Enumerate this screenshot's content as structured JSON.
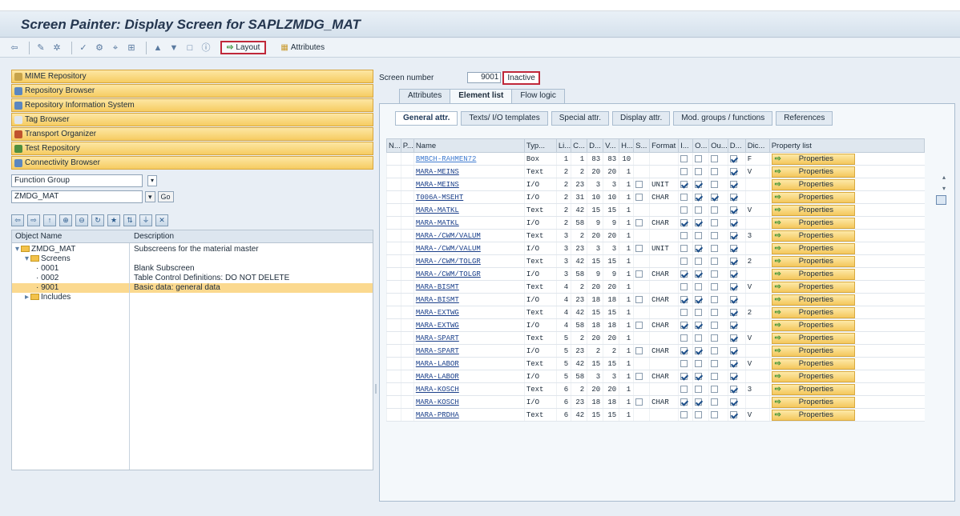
{
  "title": "Screen Painter: Display Screen for SAPLZMDG_MAT",
  "toolbar": {
    "layout_label": "Layout",
    "attributes_label": "Attributes"
  },
  "nav_buttons": [
    {
      "label": "MIME Repository",
      "icon_color": "#c7a34a"
    },
    {
      "label": "Repository Browser",
      "icon_color": "#5b87c0"
    },
    {
      "label": "Repository Information System",
      "icon_color": "#5b87c0"
    },
    {
      "label": "Tag Browser",
      "icon_color": "#e0e6ee"
    },
    {
      "label": "Transport Organizer",
      "icon_color": "#c0532e"
    },
    {
      "label": "Test Repository",
      "icon_color": "#4f8f3f"
    },
    {
      "label": "Connectivity Browser",
      "icon_color": "#5b87c0"
    }
  ],
  "object_type": "Function Group",
  "object_name": "ZMDG_MAT",
  "go_label": "Go",
  "tree": {
    "headers": [
      "Object Name",
      "Description"
    ],
    "rows": [
      {
        "name": "ZMDG_MAT",
        "desc": "Subscreens for the material master"
      },
      {
        "name": "Screens",
        "desc": ""
      },
      {
        "name": "0001",
        "desc": "Blank Subscreen"
      },
      {
        "name": "0002",
        "desc": "Table Control Definitions: DO NOT DELETE"
      },
      {
        "name": "9001",
        "desc": "Basic data: general data"
      },
      {
        "name": "Includes",
        "desc": ""
      }
    ]
  },
  "screen_number_label": "Screen number",
  "screen_number": "9001",
  "screen_status": "Inactive",
  "tabs": [
    "Attributes",
    "Element list",
    "Flow logic"
  ],
  "subtabs": [
    "General attr.",
    "Texts/ I/O templates",
    "Special attr.",
    "Display attr.",
    "Mod. groups / functions",
    "References"
  ],
  "columns": [
    "N...",
    "P...",
    "Name",
    "Typ...",
    "Li...",
    "C...",
    "D...",
    "V...",
    "H...",
    "S...",
    "Format",
    "I...",
    "O...",
    "Ou...",
    "D...",
    "Dic...",
    "Property list"
  ],
  "property_button_label": "Properties",
  "elements": [
    {
      "name": "BMBCH-RAHMEN72",
      "type": "Box",
      "li": "1",
      "c": "1",
      "d": "83",
      "v": "83",
      "h": "10",
      "s": "",
      "fmt": "",
      "i": false,
      "o": false,
      "ou": false,
      "dd": true,
      "dic": "F"
    },
    {
      "name": "MARA-MEINS",
      "type": "Text",
      "li": "2",
      "c": "2",
      "d": "20",
      "v": "20",
      "h": "1",
      "s": "",
      "fmt": "",
      "i": false,
      "o": false,
      "ou": false,
      "dd": true,
      "dic": "V"
    },
    {
      "name": "MARA-MEINS",
      "type": "I/O",
      "li": "2",
      "c": "23",
      "d": "3",
      "v": "3",
      "h": "1",
      "s": "cb",
      "fmt": "UNIT",
      "i": true,
      "o": true,
      "ou": false,
      "dd": true,
      "dic": ""
    },
    {
      "name": "T006A-MSEHT",
      "type": "I/O",
      "li": "2",
      "c": "31",
      "d": "10",
      "v": "10",
      "h": "1",
      "s": "cb",
      "fmt": "CHAR",
      "i": false,
      "o": true,
      "ou": true,
      "dd": true,
      "dic": ""
    },
    {
      "name": "MARA-MATKL",
      "type": "Text",
      "li": "2",
      "c": "42",
      "d": "15",
      "v": "15",
      "h": "1",
      "s": "",
      "fmt": "",
      "i": false,
      "o": false,
      "ou": false,
      "dd": true,
      "dic": "V"
    },
    {
      "name": "MARA-MATKL",
      "type": "I/O",
      "li": "2",
      "c": "58",
      "d": "9",
      "v": "9",
      "h": "1",
      "s": "cb",
      "fmt": "CHAR",
      "i": true,
      "o": true,
      "ou": false,
      "dd": true,
      "dic": ""
    },
    {
      "name": "MARA-/CWM/VALUM",
      "type": "Text",
      "li": "3",
      "c": "2",
      "d": "20",
      "v": "20",
      "h": "1",
      "s": "",
      "fmt": "",
      "i": false,
      "o": false,
      "ou": false,
      "dd": true,
      "dic": "3"
    },
    {
      "name": "MARA-/CWM/VALUM",
      "type": "I/O",
      "li": "3",
      "c": "23",
      "d": "3",
      "v": "3",
      "h": "1",
      "s": "cb",
      "fmt": "UNIT",
      "i": false,
      "o": true,
      "ou": false,
      "dd": true,
      "dic": ""
    },
    {
      "name": "MARA-/CWM/TOLGR",
      "type": "Text",
      "li": "3",
      "c": "42",
      "d": "15",
      "v": "15",
      "h": "1",
      "s": "",
      "fmt": "",
      "i": false,
      "o": false,
      "ou": false,
      "dd": true,
      "dic": "2"
    },
    {
      "name": "MARA-/CWM/TOLGR",
      "type": "I/O",
      "li": "3",
      "c": "58",
      "d": "9",
      "v": "9",
      "h": "1",
      "s": "cb",
      "fmt": "CHAR",
      "i": true,
      "o": true,
      "ou": false,
      "dd": true,
      "dic": ""
    },
    {
      "name": "MARA-BISMT",
      "type": "Text",
      "li": "4",
      "c": "2",
      "d": "20",
      "v": "20",
      "h": "1",
      "s": "",
      "fmt": "",
      "i": false,
      "o": false,
      "ou": false,
      "dd": true,
      "dic": "V"
    },
    {
      "name": "MARA-BISMT",
      "type": "I/O",
      "li": "4",
      "c": "23",
      "d": "18",
      "v": "18",
      "h": "1",
      "s": "cb",
      "fmt": "CHAR",
      "i": true,
      "o": true,
      "ou": false,
      "dd": true,
      "dic": ""
    },
    {
      "name": "MARA-EXTWG",
      "type": "Text",
      "li": "4",
      "c": "42",
      "d": "15",
      "v": "15",
      "h": "1",
      "s": "",
      "fmt": "",
      "i": false,
      "o": false,
      "ou": false,
      "dd": true,
      "dic": "2"
    },
    {
      "name": "MARA-EXTWG",
      "type": "I/O",
      "li": "4",
      "c": "58",
      "d": "18",
      "v": "18",
      "h": "1",
      "s": "cb",
      "fmt": "CHAR",
      "i": true,
      "o": true,
      "ou": false,
      "dd": true,
      "dic": ""
    },
    {
      "name": "MARA-SPART",
      "type": "Text",
      "li": "5",
      "c": "2",
      "d": "20",
      "v": "20",
      "h": "1",
      "s": "",
      "fmt": "",
      "i": false,
      "o": false,
      "ou": false,
      "dd": true,
      "dic": "V"
    },
    {
      "name": "MARA-SPART",
      "type": "I/O",
      "li": "5",
      "c": "23",
      "d": "2",
      "v": "2",
      "h": "1",
      "s": "cb",
      "fmt": "CHAR",
      "i": true,
      "o": true,
      "ou": false,
      "dd": true,
      "dic": ""
    },
    {
      "name": "MARA-LABOR",
      "type": "Text",
      "li": "5",
      "c": "42",
      "d": "15",
      "v": "15",
      "h": "1",
      "s": "",
      "fmt": "",
      "i": false,
      "o": false,
      "ou": false,
      "dd": true,
      "dic": "V"
    },
    {
      "name": "MARA-LABOR",
      "type": "I/O",
      "li": "5",
      "c": "58",
      "d": "3",
      "v": "3",
      "h": "1",
      "s": "cb",
      "fmt": "CHAR",
      "i": true,
      "o": true,
      "ou": false,
      "dd": true,
      "dic": ""
    },
    {
      "name": "MARA-KOSCH",
      "type": "Text",
      "li": "6",
      "c": "2",
      "d": "20",
      "v": "20",
      "h": "1",
      "s": "",
      "fmt": "",
      "i": false,
      "o": false,
      "ou": false,
      "dd": true,
      "dic": "3"
    },
    {
      "name": "MARA-KOSCH",
      "type": "I/O",
      "li": "6",
      "c": "23",
      "d": "18",
      "v": "18",
      "h": "1",
      "s": "cb",
      "fmt": "CHAR",
      "i": true,
      "o": true,
      "ou": false,
      "dd": true,
      "dic": ""
    },
    {
      "name": "MARA-PRDHA",
      "type": "Text",
      "li": "6",
      "c": "42",
      "d": "15",
      "v": "15",
      "h": "1",
      "s": "",
      "fmt": "",
      "i": false,
      "o": false,
      "ou": false,
      "dd": true,
      "dic": "V"
    }
  ]
}
